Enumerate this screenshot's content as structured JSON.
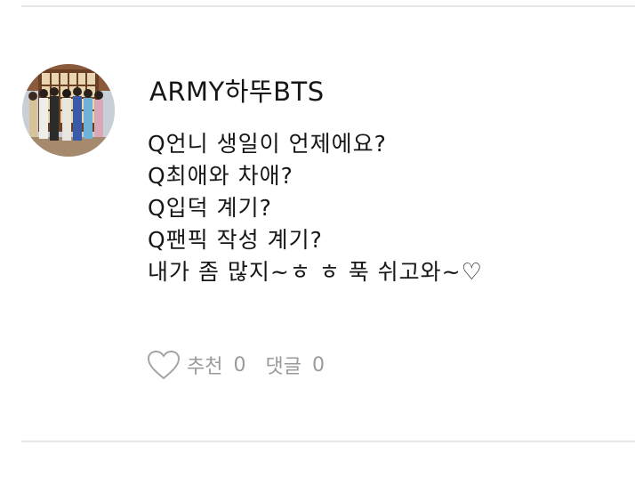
{
  "post": {
    "author": "ARMY하뚜BTS",
    "lines": [
      "Q언니 생일이 언제에요?",
      "Q최애와 차애?",
      "Q입덕  계기?",
      "Q팬픽 작성 계기?",
      "내가 좀 많지~ㅎ ㅎ  푹 쉬고와~"
    ],
    "last_line_heart": "♡",
    "actions": {
      "recommend_label": "추천",
      "recommend_count": "0",
      "comment_label": "댓글",
      "comment_count": "0"
    },
    "colors": {
      "text": "#171717",
      "action_gray": "#9a9a9a",
      "divider": "#e6e6e6"
    },
    "icons": [
      "heart-outline-icon"
    ]
  }
}
